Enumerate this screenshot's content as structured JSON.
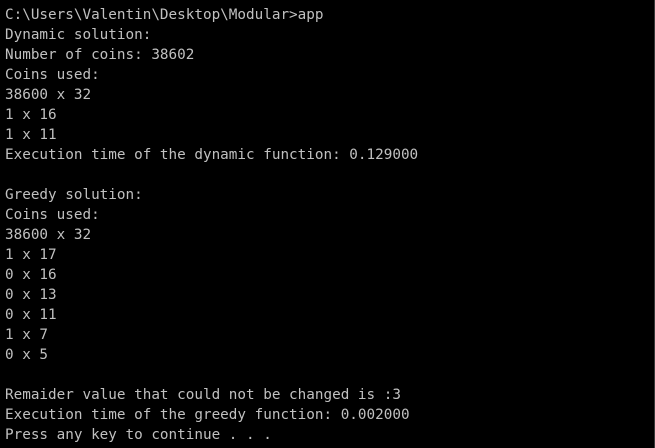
{
  "console": {
    "text_color": "#c0c0c0",
    "background_color": "#000000",
    "lines": [
      "C:\\Users\\Valentin\\Desktop\\Modular>app",
      "Dynamic solution:",
      "Number of coins: 38602",
      "Coins used:",
      "38600 x 32",
      "1 x 16",
      "1 x 11",
      "Execution time of the dynamic function: 0.129000",
      "",
      "Greedy solution:",
      "Coins used:",
      "38600 x 32",
      "1 x 17",
      "0 x 16",
      "0 x 13",
      "0 x 11",
      "1 x 7",
      "0 x 5",
      "",
      "Remaider value that could not be changed is :3",
      "Execution time of the greedy function: 0.002000",
      "Press any key to continue . . ."
    ]
  }
}
